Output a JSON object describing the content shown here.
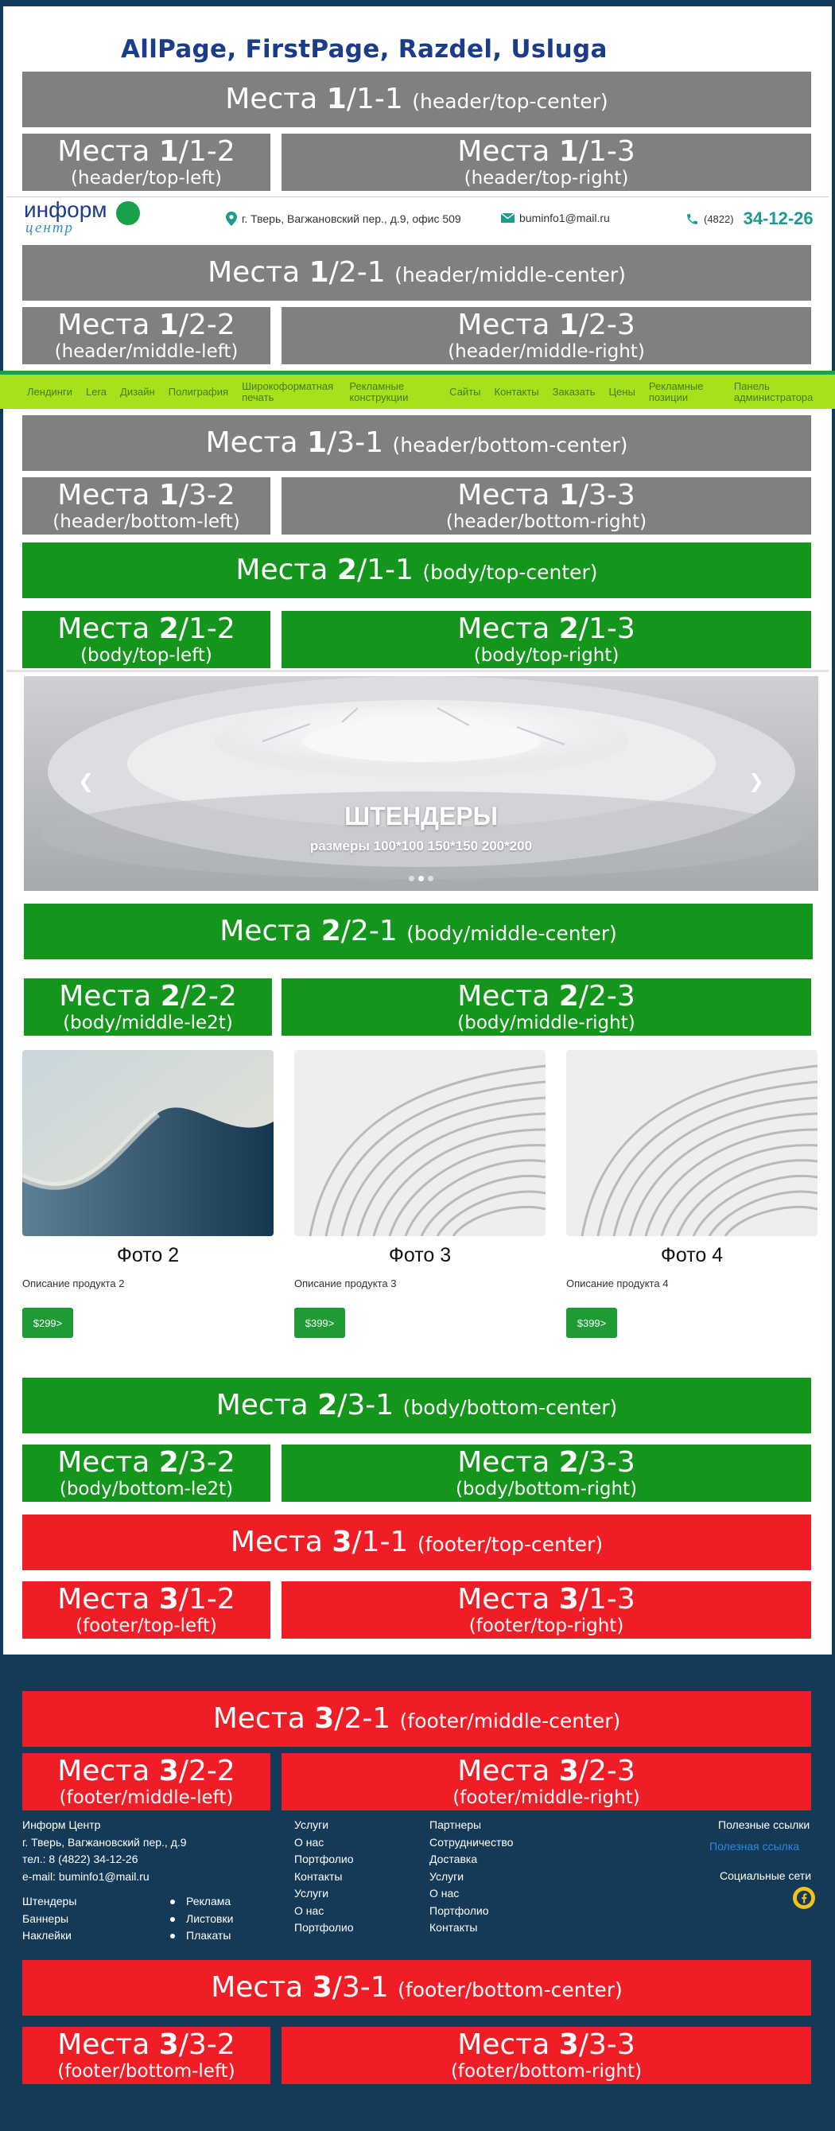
{
  "page_title": "AllPage, FirstPage, Razdel, Usluga",
  "slots": {
    "h_top_center": {
      "num": "1",
      "pos": "/1-1",
      "label": "(header/top-center)"
    },
    "h_top_left": {
      "num": "1",
      "pos": "/1-2",
      "label": "(header/top-left)"
    },
    "h_top_right": {
      "num": "1",
      "pos": "/1-3",
      "label": "(header/top-right)"
    },
    "h_mid_center": {
      "num": "1",
      "pos": "/2-1",
      "label": "(header/middle-center)"
    },
    "h_mid_left": {
      "num": "1",
      "pos": "/2-2",
      "label": "(header/middle-left)"
    },
    "h_mid_right": {
      "num": "1",
      "pos": "/2-3",
      "label": "(header/middle-right)"
    },
    "h_bot_center": {
      "num": "1",
      "pos": "/3-1",
      "label": "(header/bottom-center)"
    },
    "h_bot_left": {
      "num": "1",
      "pos": "/3-2",
      "label": "(header/bottom-left)"
    },
    "h_bot_right": {
      "num": "1",
      "pos": "/3-3",
      "label": "(header/bottom-right)"
    },
    "b_top_center": {
      "num": "2",
      "pos": "/1-1",
      "label": "(body/top-center)"
    },
    "b_top_left": {
      "num": "2",
      "pos": "/1-2",
      "label": "(body/top-left)"
    },
    "b_top_right": {
      "num": "2",
      "pos": "/1-3",
      "label": "(body/top-right)"
    },
    "b_mid_center": {
      "num": "2",
      "pos": "/2-1",
      "label": "(body/middle-center)"
    },
    "b_mid_left": {
      "num": "2",
      "pos": "/2-2",
      "label": "(body/middle-le2t)"
    },
    "b_mid_right": {
      "num": "2",
      "pos": "/2-3",
      "label": "(body/middle-right)"
    },
    "b_bot_center": {
      "num": "2",
      "pos": "/3-1",
      "label": "(body/bottom-center)"
    },
    "b_bot_left": {
      "num": "2",
      "pos": "/3-2",
      "label": "(body/bottom-le2t)"
    },
    "b_bot_right": {
      "num": "2",
      "pos": "/3-3",
      "label": "(body/bottom-right)"
    },
    "f_top_center": {
      "num": "3",
      "pos": "/1-1",
      "label": "(footer/top-center)"
    },
    "f_top_left": {
      "num": "3",
      "pos": "/1-2",
      "label": "(footer/top-left)"
    },
    "f_top_right": {
      "num": "3",
      "pos": "/1-3",
      "label": "(footer/top-right)"
    },
    "f_mid_center": {
      "num": "3",
      "pos": "/2-1",
      "label": "(footer/middle-center)"
    },
    "f_mid_left": {
      "num": "3",
      "pos": "/2-2",
      "label": "(footer/middle-left)"
    },
    "f_mid_right": {
      "num": "3",
      "pos": "/2-3",
      "label": "(footer/middle-right)"
    },
    "f_bot_center": {
      "num": "3",
      "pos": "/3-1",
      "label": "(footer/bottom-center)"
    },
    "f_bot_left": {
      "num": "3",
      "pos": "/3-2",
      "label": "(footer/bottom-left)"
    },
    "f_bot_right": {
      "num": "3",
      "pos": "/3-3",
      "label": "(footer/bottom-right)"
    }
  },
  "slot_word": "Места",
  "contact": {
    "logo_word1": "информ",
    "logo_word2": "центр",
    "address": "г. Тверь, Вагжановский пер., д.9, офис 509",
    "email": "buminfo1@mail.ru",
    "phone_code": "(4822)",
    "phone_number": "34-12-26"
  },
  "nav": [
    "Лендинги",
    "Lera",
    "Дизайн",
    "Полиграфия",
    "Широкоформатная печать",
    "Рекламные конструкции",
    "Сайты",
    "Контакты",
    "Заказать",
    "Цены",
    "Рекламные позиции",
    "Панель администратора"
  ],
  "slider": {
    "caption": "ШТЕНДЕРЫ",
    "subcaption": "размеры 100*100 150*150 200*200",
    "active_dot": 2,
    "dots": 3
  },
  "products": [
    {
      "title": "Фото 2",
      "desc": "Описание продукта 2",
      "price": "$299>"
    },
    {
      "title": "Фото 3",
      "desc": "Описание продукта 3",
      "price": "$399>"
    },
    {
      "title": "Фото 4",
      "desc": "Описание продукта 4",
      "price": "$399>"
    }
  ],
  "footer": {
    "company": [
      "Информ Центр",
      "г. Тверь, Вагжановский пер., д.9",
      "тел.: 8 (4822) 34-12-26",
      "e-mail: buminfo1@mail.ru"
    ],
    "links_a": [
      "Штендеры",
      "Баннеры",
      "Наклейки"
    ],
    "links_b": [
      "Реклама",
      "Листовки",
      "Плакаты"
    ],
    "col2": [
      "Услуги",
      "О нас",
      "Портфолио",
      "Контакты",
      "Услуги",
      "О нас",
      "Портфолио"
    ],
    "col3": [
      "Партнеры",
      "Сотрудничество",
      "Доставка",
      "Услуги",
      "О нас",
      "Портфолио",
      "Контакты"
    ],
    "useful_title": "Полезные ссылки",
    "useful_link": "Полезная ссылка",
    "social_title": "Социальные сети",
    "colors": {
      "bg": "#143a58",
      "link": "#2b8be6"
    }
  }
}
